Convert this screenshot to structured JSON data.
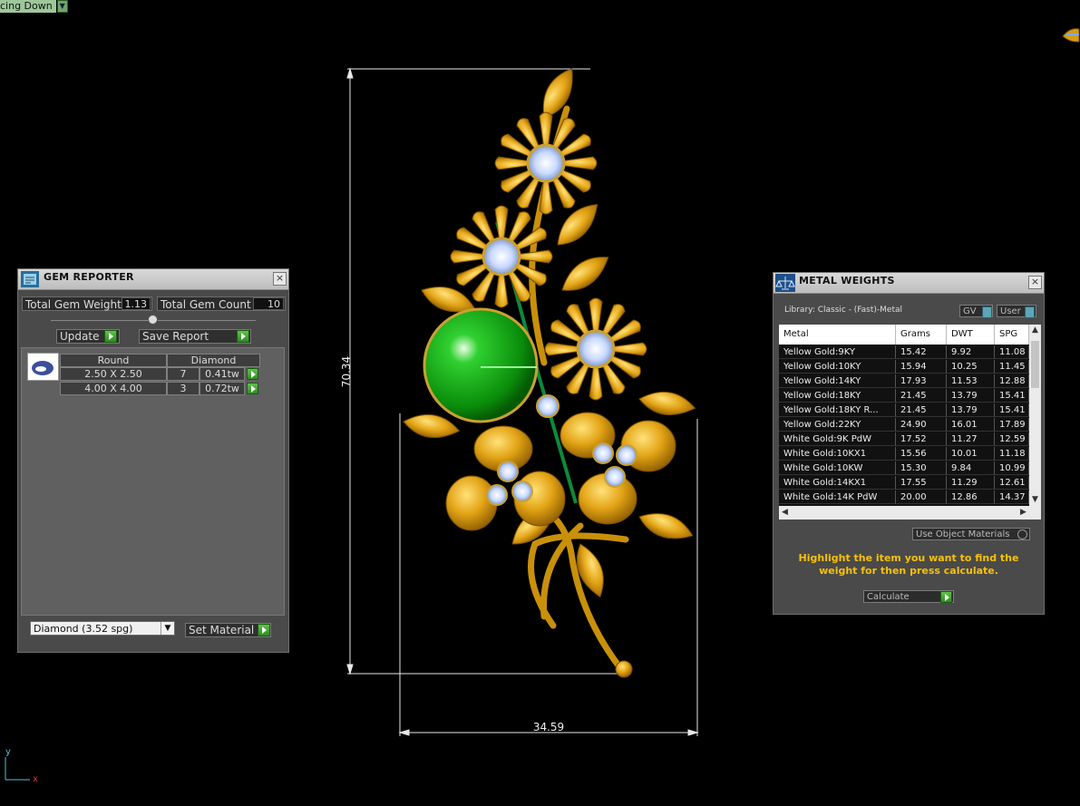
{
  "viewport": {
    "view_label": "cing Down",
    "dimension_vertical": "70.34",
    "dimension_horizontal": "34.59",
    "axis_y": "y",
    "axis_x": "x"
  },
  "gem_reporter": {
    "title": "GEM REPORTER",
    "total_weight_label": "Total Gem Weight",
    "total_weight_value": "1.13",
    "total_count_label": "Total Gem Count",
    "total_count_value": "10",
    "update_label": "Update",
    "save_report_label": "Save Report",
    "headers": [
      "Round",
      "Diamond"
    ],
    "rows": [
      {
        "size": "2.50 X 2.50",
        "count": "7",
        "weight": "0.41tw"
      },
      {
        "size": "4.00 X 4.00",
        "count": "3",
        "weight": "0.72tw"
      }
    ],
    "material_select": "Diamond     (3.52 spg)",
    "set_material_label": "Set Material"
  },
  "metal_weights": {
    "title": "METAL WEIGHTS",
    "library": "Library: Classic - (Fast)-Metal",
    "toggle_gv": "GV",
    "toggle_user": "User",
    "columns": [
      "Metal",
      "Grams",
      "DWT",
      "SPG"
    ],
    "rows": [
      {
        "metal": "Yellow Gold:9KY",
        "grams": "15.42",
        "dwt": "9.92",
        "spg": "11.08"
      },
      {
        "metal": "Yellow Gold:10KY",
        "grams": "15.94",
        "dwt": "10.25",
        "spg": "11.45"
      },
      {
        "metal": "Yellow Gold:14KY",
        "grams": "17.93",
        "dwt": "11.53",
        "spg": "12.88"
      },
      {
        "metal": "Yellow Gold:18KY",
        "grams": "21.45",
        "dwt": "13.79",
        "spg": "15.41"
      },
      {
        "metal": "Yellow Gold:18KY R...",
        "grams": "21.45",
        "dwt": "13.79",
        "spg": "15.41"
      },
      {
        "metal": "Yellow Gold:22KY",
        "grams": "24.90",
        "dwt": "16.01",
        "spg": "17.89"
      },
      {
        "metal": "White Gold:9K PdW",
        "grams": "17.52",
        "dwt": "11.27",
        "spg": "12.59"
      },
      {
        "metal": "White Gold:10KX1",
        "grams": "15.56",
        "dwt": "10.01",
        "spg": "11.18"
      },
      {
        "metal": "White Gold:10KW",
        "grams": "15.30",
        "dwt": "9.84",
        "spg": "10.99"
      },
      {
        "metal": "White Gold:14KX1",
        "grams": "17.55",
        "dwt": "11.29",
        "spg": "12.61"
      },
      {
        "metal": "White Gold:14K PdW",
        "grams": "20.00",
        "dwt": "12.86",
        "spg": "14.37"
      }
    ],
    "use_object_materials": "Use Object Materials",
    "instruction": "Highlight the item you want to find the weight for then press calculate.",
    "calculate_label": "Calculate"
  }
}
